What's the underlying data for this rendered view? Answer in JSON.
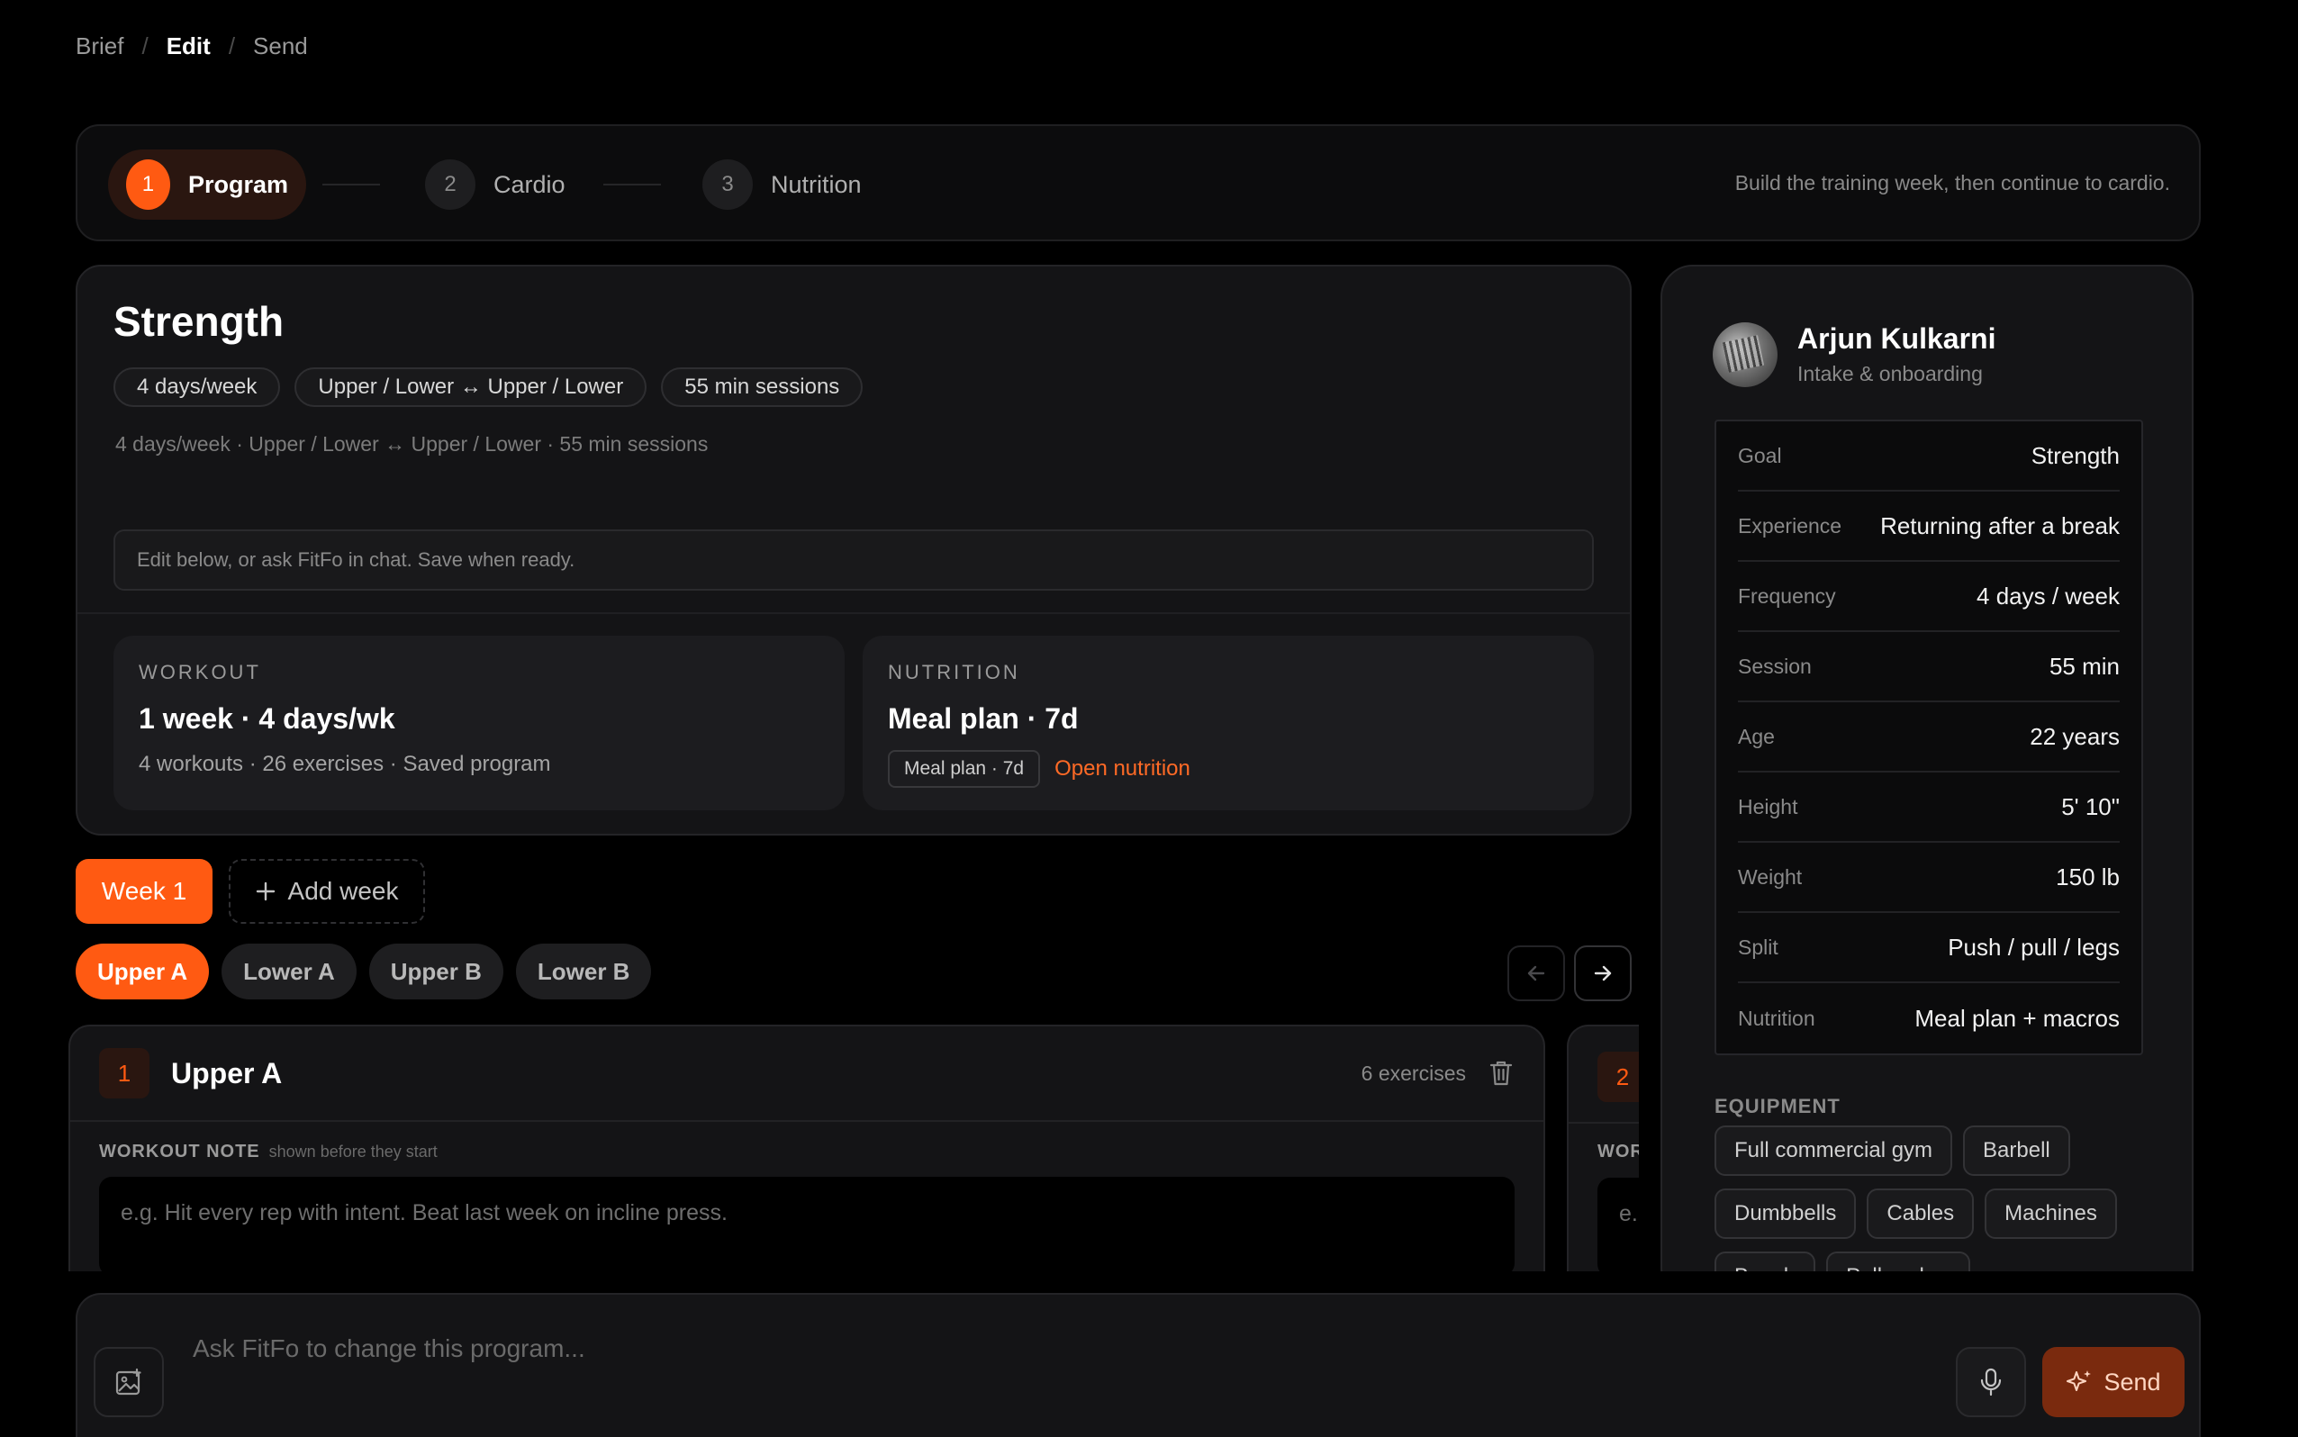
{
  "breadcrumb": {
    "items": [
      "Brief",
      "Edit",
      "Send"
    ],
    "separator": "/"
  },
  "stepper": {
    "steps": [
      {
        "num": "1",
        "label": "Program"
      },
      {
        "num": "2",
        "label": "Cardio"
      },
      {
        "num": "3",
        "label": "Nutrition"
      }
    ],
    "hint": "Build the training week, then continue to cardio."
  },
  "program": {
    "title": "Strength",
    "chips": [
      "4 days/week",
      "Upper / Lower ↔ Upper / Lower",
      "55 min sessions"
    ],
    "summary": "4 days/week · Upper / Lower ↔ Upper / Lower · 55 min sessions",
    "edit_hint": "Edit below, or ask FitFo in chat. Save when ready.",
    "workout": {
      "label": "WORKOUT",
      "title": "1 week · 4 days/wk",
      "sub": "4 workouts · 26 exercises · Saved program"
    },
    "nutrition": {
      "label": "NUTRITION",
      "title": "Meal plan · 7d",
      "chip": "Meal plan · 7d",
      "link": "Open nutrition"
    }
  },
  "weeks": {
    "current": "Week 1",
    "add_label": "Add week"
  },
  "days": [
    "Upper A",
    "Lower A",
    "Upper B",
    "Lower B"
  ],
  "workout_card": {
    "num": "1",
    "title": "Upper A",
    "count": "6 exercises",
    "note_label": "WORKOUT NOTE",
    "note_hint": "shown before they start",
    "note_placeholder": "e.g. Hit every rep with intent. Beat last week on incline press."
  },
  "workout_card_2": {
    "num": "2",
    "label": "WOR",
    "note_placeholder": "e."
  },
  "client": {
    "name": "Arjun Kulkarni",
    "sub": "Intake & onboarding",
    "stats": [
      {
        "label": "Goal",
        "value": "Strength"
      },
      {
        "label": "Experience",
        "value": "Returning after a break"
      },
      {
        "label": "Frequency",
        "value": "4 days / week"
      },
      {
        "label": "Session",
        "value": "55 min"
      },
      {
        "label": "Age",
        "value": "22 years"
      },
      {
        "label": "Height",
        "value": "5' 10\""
      },
      {
        "label": "Weight",
        "value": "150 lb"
      },
      {
        "label": "Split",
        "value": "Push / pull / legs"
      },
      {
        "label": "Nutrition",
        "value": "Meal plan + macros"
      }
    ],
    "equipment_label": "EQUIPMENT",
    "equipment": [
      "Full commercial gym",
      "Barbell",
      "Dumbbells",
      "Cables",
      "Machines",
      "Bench",
      "Pull-up bar"
    ]
  },
  "chat": {
    "placeholder": "Ask FitFo to change this program...",
    "send_label": "Send"
  },
  "colors": {
    "accent": "#ff5a12",
    "background": "#000000",
    "card": "#141416"
  },
  "icons": [
    "image-upload-icon",
    "mic-icon",
    "sparkle-icon",
    "trash-icon",
    "arrow-left-icon",
    "arrow-right-icon",
    "plus-icon"
  ]
}
